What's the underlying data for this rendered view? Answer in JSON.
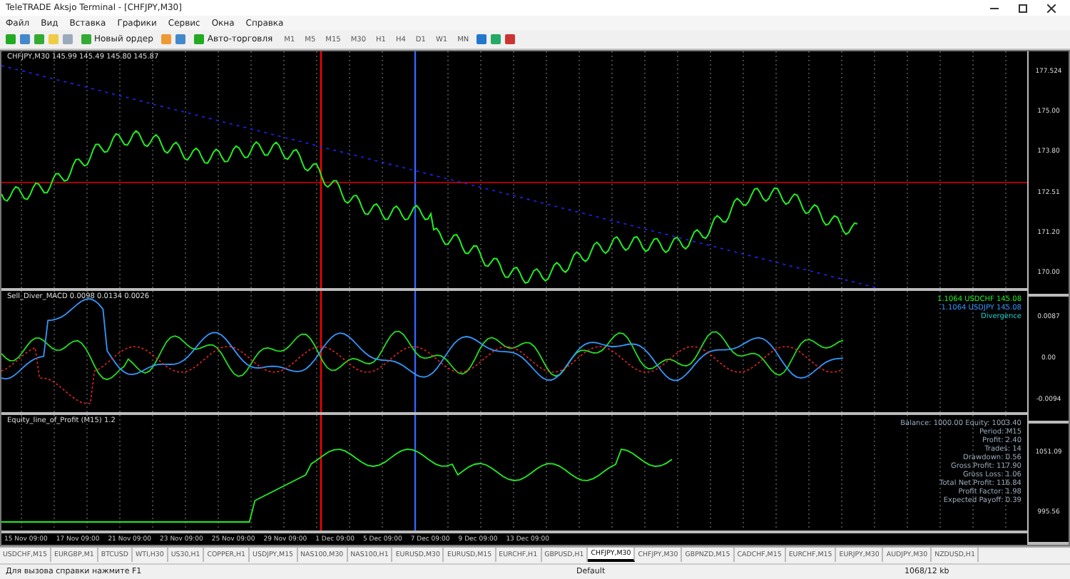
{
  "window": {
    "title": "TeleTRADE Aksjo Terminal - [CHFJPY,M30]"
  },
  "menu": [
    "Файл",
    "Вид",
    "Вставка",
    "Графики",
    "Сервис",
    "Окна",
    "Справка"
  ],
  "toolbar": {
    "new_order": "Новый ордер",
    "auto_trading": "Авто-торговля",
    "timeframes": [
      "M1",
      "M5",
      "M15",
      "M30",
      "H1",
      "H4",
      "D1",
      "W1",
      "MN"
    ]
  },
  "chart": {
    "title": "CHFJPY,M30  145.99 145.49 145.80 145.87",
    "indicator_title": "Sell_Diver_MACD 0.0098 0.0134 0.0026",
    "indicator_labels": [
      "1.1064 USDCHF 145.08",
      "1.1064 USDJPY 145.08",
      "Divergence"
    ],
    "third_title": "Equity_line_of_Profit (M15) 1.2",
    "stats": [
      "Balance: 1000.00 Equity: 1003.40",
      "Period: M15",
      "Profit: 2.40",
      "Trades: 14",
      "Drawdown: 0.56",
      "Gross Profit: 117.90",
      "Gross Loss: 1.06",
      "Total Net Profit: 116.84",
      "Profit Factor: 1.98",
      "Expected Payoff: 0.39"
    ],
    "price_labels": [
      "177.524",
      "175.00",
      "173.80",
      "172.51",
      "171.20",
      "170.00"
    ],
    "indicator_scale": [
      "0.0087",
      "0.00",
      "-0.0094"
    ],
    "third_scale": [
      "1051.09",
      "995.56"
    ],
    "time_labels": [
      "15 Nov 09:00",
      "17 Nov 09:00",
      "21 Nov 09:00",
      "23 Nov 09:00",
      "25 Nov 09:00",
      "29 Nov 09:00",
      "1 Dec 09:00",
      "5 Dec 09:00",
      "7 Dec 09:00",
      "9 Dec 09:00",
      "13 Dec 09:00"
    ]
  },
  "tabs": [
    {
      "label": "USDCHF,M15",
      "selected": false
    },
    {
      "label": "EURGBP,M1",
      "selected": false
    },
    {
      "label": "BTCUSD",
      "selected": false
    },
    {
      "label": "WTI,H30",
      "selected": false
    },
    {
      "label": "US30,H1",
      "selected": false
    },
    {
      "label": "COPPER,H1",
      "selected": false
    },
    {
      "label": "USDJPY,M15",
      "selected": false
    },
    {
      "label": "NAS100,M30",
      "selected": false
    },
    {
      "label": "NAS100,H1",
      "selected": false
    },
    {
      "label": "EURUSD,M30",
      "selected": false
    },
    {
      "label": "EURUSD,M15",
      "selected": false
    },
    {
      "label": "EURCHF,H1",
      "selected": false
    },
    {
      "label": "GBPUSD,H1",
      "selected": false
    },
    {
      "label": "CHFJPY,M30",
      "selected": true
    },
    {
      "label": "CHFJPY,M30",
      "selected": false
    },
    {
      "label": "GBPNZD,M15",
      "selected": false
    },
    {
      "label": "CADCHF,M15",
      "selected": false
    },
    {
      "label": "EURCHF,M15",
      "selected": false
    },
    {
      "label": "EURJPY,M30",
      "selected": false
    },
    {
      "label": "AUDJPY,M30",
      "selected": false
    },
    {
      "label": "NZDUSD,H1",
      "selected": false
    }
  ],
  "status_bar": {
    "help": "Для вызова справки нажмите F1",
    "profile": "Default",
    "traffic": "1068/12 kb"
  }
}
